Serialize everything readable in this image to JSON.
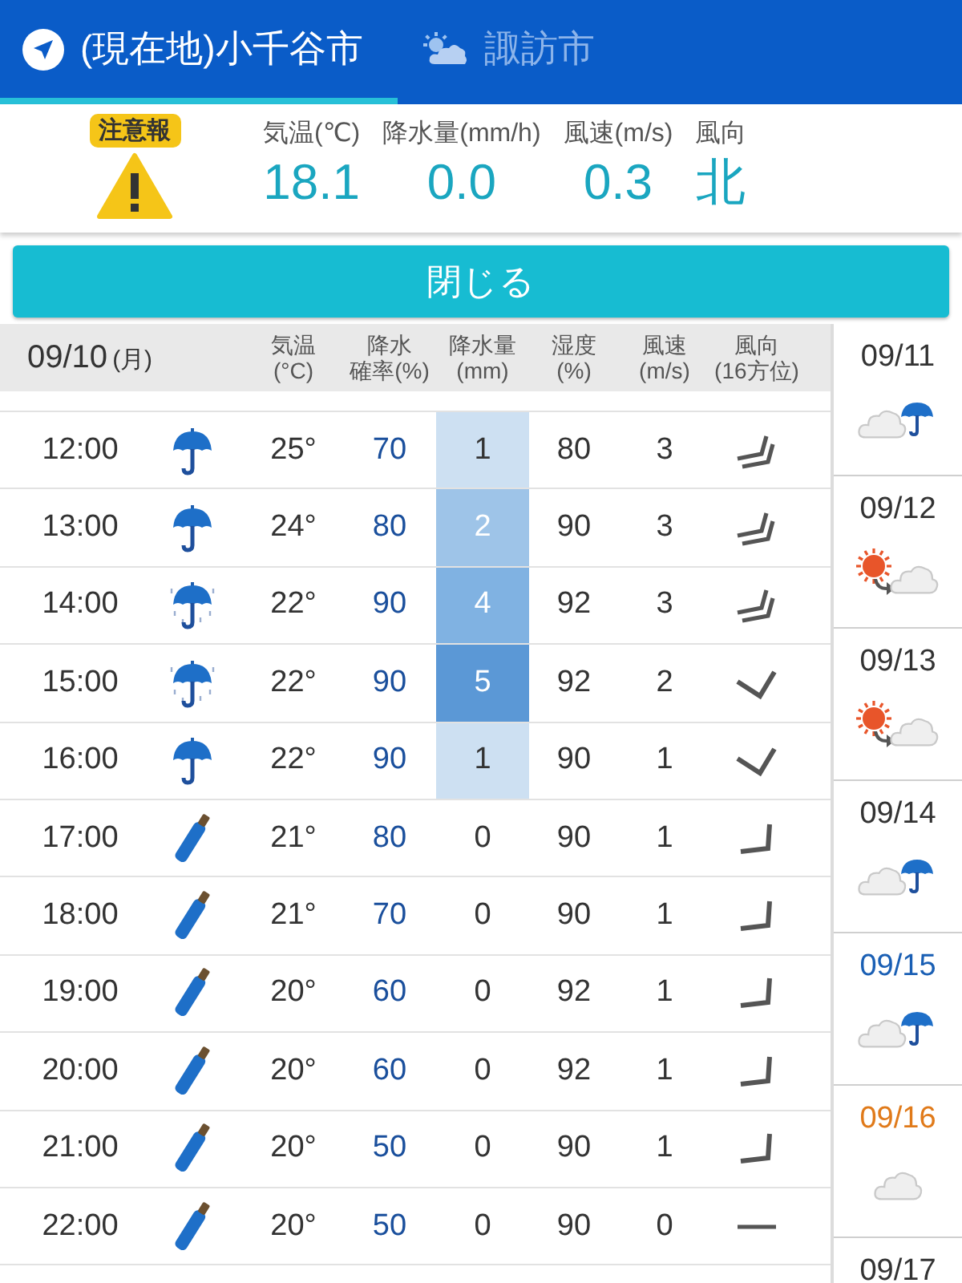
{
  "tabs": [
    {
      "label": "(現在地)小千谷市",
      "selected": true
    },
    {
      "label": "諏訪市",
      "selected": false
    }
  ],
  "current": {
    "alert": "注意報",
    "readings": [
      {
        "label": "気温(℃)",
        "value": "18.1"
      },
      {
        "label": "降水量(mm/h)",
        "value": "0.0"
      },
      {
        "label": "風速(m/s)",
        "value": "0.3"
      },
      {
        "label": "風向",
        "value": "北"
      }
    ]
  },
  "close_button": "閉じる",
  "hourly": {
    "date": "09/10",
    "weekday": "(月)",
    "columns": [
      {
        "line_1": "気温",
        "line_2": "(°C)"
      },
      {
        "line_1": "降水",
        "line_2": "確率(%)"
      },
      {
        "line_1": "降水量",
        "line_2": "(mm)"
      },
      {
        "line_1": "湿度",
        "line_2": "(%)"
      },
      {
        "line_1": "風速",
        "line_2": "(m/s)"
      },
      {
        "line_1": "風向",
        "line_2": "(16方位)"
      }
    ],
    "rows": [
      {
        "time": "12:00",
        "weather": {
          "kind": "umbrella"
        },
        "temp": "25°",
        "chance": "70",
        "rain": {
          "value": "1",
          "color": "#cde0f2"
        },
        "humidity": "80",
        "wind_speed": "3",
        "wind_direction": {
          "kind": "double"
        }
      },
      {
        "time": "13:00",
        "weather": {
          "kind": "umbrella"
        },
        "temp": "24°",
        "chance": "80",
        "rain": {
          "value": "2",
          "color": "#9ec4e8"
        },
        "humidity": "90",
        "wind_speed": "3",
        "wind_direction": {
          "kind": "double"
        }
      },
      {
        "time": "14:00",
        "weather": {
          "kind": "rain"
        },
        "temp": "22°",
        "chance": "90",
        "rain": {
          "value": "4",
          "color": "#80b2e2"
        },
        "humidity": "92",
        "wind_speed": "3",
        "wind_direction": {
          "kind": "double"
        }
      },
      {
        "time": "15:00",
        "weather": {
          "kind": "rain"
        },
        "temp": "22°",
        "chance": "90",
        "rain": {
          "value": "5",
          "color": "#5b98d6"
        },
        "humidity": "92",
        "wind_speed": "2",
        "wind_direction": {
          "kind": "check"
        }
      },
      {
        "time": "16:00",
        "weather": {
          "kind": "umbrella"
        },
        "temp": "22°",
        "chance": "90",
        "rain": {
          "value": "1",
          "color": "#cde0f2"
        },
        "humidity": "90",
        "wind_speed": "1",
        "wind_direction": {
          "kind": "check"
        }
      },
      {
        "time": "17:00",
        "weather": {
          "kind": "closed"
        },
        "temp": "21°",
        "chance": "80",
        "rain": {
          "value": "0"
        },
        "humidity": "90",
        "wind_speed": "1",
        "wind_direction": {
          "kind": "corner"
        }
      },
      {
        "time": "18:00",
        "weather": {
          "kind": "closed"
        },
        "temp": "21°",
        "chance": "70",
        "rain": {
          "value": "0"
        },
        "humidity": "90",
        "wind_speed": "1",
        "wind_direction": {
          "kind": "corner"
        }
      },
      {
        "time": "19:00",
        "weather": {
          "kind": "closed"
        },
        "temp": "20°",
        "chance": "60",
        "rain": {
          "value": "0"
        },
        "humidity": "92",
        "wind_speed": "1",
        "wind_direction": {
          "kind": "corner"
        }
      },
      {
        "time": "20:00",
        "weather": {
          "kind": "closed"
        },
        "temp": "20°",
        "chance": "60",
        "rain": {
          "value": "0"
        },
        "humidity": "92",
        "wind_speed": "1",
        "wind_direction": {
          "kind": "corner"
        }
      },
      {
        "time": "21:00",
        "weather": {
          "kind": "closed"
        },
        "temp": "20°",
        "chance": "50",
        "rain": {
          "value": "0"
        },
        "humidity": "90",
        "wind_speed": "1",
        "wind_direction": {
          "kind": "corner"
        }
      },
      {
        "time": "22:00",
        "weather": {
          "kind": "closed"
        },
        "temp": "20°",
        "chance": "50",
        "rain": {
          "value": "0"
        },
        "humidity": "90",
        "wind_speed": "0",
        "wind_direction": {
          "kind": "calm"
        }
      }
    ]
  },
  "daily": [
    {
      "date": "09/11",
      "color": "#333333",
      "weather": {
        "kind": "showers"
      }
    },
    {
      "date": "09/12",
      "color": "#333333",
      "weather": {
        "kind": "clearing"
      }
    },
    {
      "date": "09/13",
      "color": "#333333",
      "weather": {
        "kind": "clearing"
      }
    },
    {
      "date": "09/14",
      "color": "#333333",
      "weather": {
        "kind": "showers"
      }
    },
    {
      "date": "09/15",
      "color": "#1a5fb4",
      "weather": {
        "kind": "showers"
      }
    },
    {
      "date": "09/16",
      "color": "#e07a1a",
      "weather": {
        "kind": "cloud"
      }
    },
    {
      "date": "09/17",
      "color": "#333333"
    }
  ]
}
